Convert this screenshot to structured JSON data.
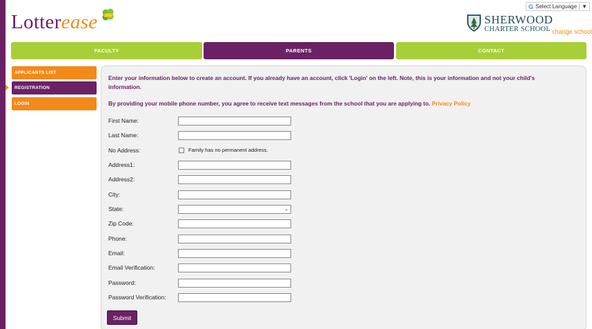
{
  "header": {
    "logo_main": "Lotter",
    "logo_accent": "ease",
    "language_label": "Select Language",
    "school_line1": "SHERWOOD",
    "school_line2": "CHARTER SCHOOL",
    "change_school": "change school"
  },
  "nav": {
    "faculty": "FACULTY",
    "parents": "PARENTS",
    "contact": "CONTACT"
  },
  "sidebar": {
    "items": [
      {
        "label": "APPLICANTS LIST"
      },
      {
        "label": "REGISTRATION"
      },
      {
        "label": "LOGIN"
      }
    ]
  },
  "intro": {
    "text": "Enter your information below to create an account. If you already have an account, click 'Login' on the left. Note, this is your information and not your child's information.",
    "sms_text": "By providing your mobile phone number, you agree to receive text messages from the school that you are applying to.",
    "privacy_link": "Privacy Policy"
  },
  "form": {
    "first_name": "First Name:",
    "last_name": "Last Name:",
    "no_address": "No Address:",
    "no_address_check": "Family has no permanent address.",
    "address1": "Address1:",
    "address2": "Address2:",
    "city": "City:",
    "state": "State:",
    "zip": "Zip Code:",
    "phone": "Phone:",
    "email": "Email:",
    "email_verification": "Email Verification:",
    "password": "Password:",
    "password_verification": "Password Verification:",
    "submit": "Submit"
  },
  "colors": {
    "brand_purple": "#6b2166",
    "brand_orange": "#f28a1a",
    "brand_green": "#a8cf38"
  }
}
